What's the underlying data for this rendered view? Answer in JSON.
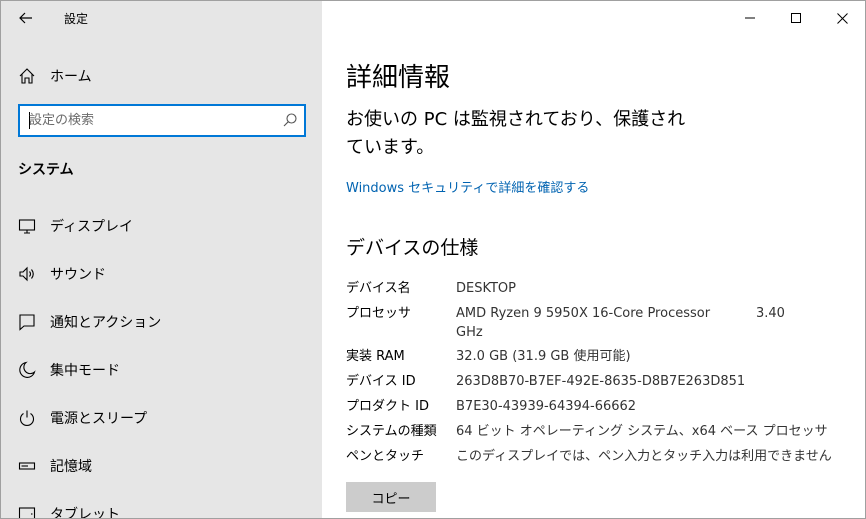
{
  "window": {
    "app_title": "設定",
    "controls": [
      "minimize-icon",
      "maximize-icon",
      "close-icon"
    ]
  },
  "sidebar": {
    "home_label": "ホーム",
    "search_placeholder": "設定の検索",
    "section_title": "システム",
    "items": [
      {
        "label": "ディスプレイ",
        "icon": "display-icon"
      },
      {
        "label": "サウンド",
        "icon": "speaker-icon"
      },
      {
        "label": "通知とアクション",
        "icon": "notification-icon"
      },
      {
        "label": "集中モード",
        "icon": "moon-icon"
      },
      {
        "label": "電源とスリープ",
        "icon": "power-icon"
      },
      {
        "label": "記憶域",
        "icon": "storage-icon"
      },
      {
        "label": "タブレット",
        "icon": "tablet-icon"
      }
    ]
  },
  "content": {
    "page_title": "詳細情報",
    "status_heading": "お使いの PC は監視されており、保護されています。",
    "security_link": "Windows セキュリティで詳細を確認する",
    "spec_title": "デバイスの仕様",
    "specs": [
      {
        "key": "デバイス名",
        "value": "DESKTOP"
      },
      {
        "key": "プロセッサ",
        "value": "AMD Ryzen 9 5950X 16-Core Processor",
        "value2": "3.40",
        "value3": "GHz"
      },
      {
        "key": "実装 RAM",
        "value": "32.0 GB (31.9 GB 使用可能)"
      },
      {
        "key": "デバイス ID",
        "value": "263D8B70-B7EF-492E-8635-D8B7E263D851"
      },
      {
        "key": "プロダクト ID",
        "value": "B7E30-43939-64394-66662"
      },
      {
        "key": "システムの種類",
        "value": "64 ビット オペレーティング システム、x64 ベース プロセッサ"
      },
      {
        "key": "ペンとタッチ",
        "value": "このディスプレイでは、ペン入力とタッチ入力は利用できません"
      }
    ],
    "copy_label": "コピー"
  },
  "colors": {
    "sidebar_bg": "#e6e6e6",
    "accent": "#0078d7",
    "link": "#0063b1",
    "button_bg": "#cccccc"
  }
}
